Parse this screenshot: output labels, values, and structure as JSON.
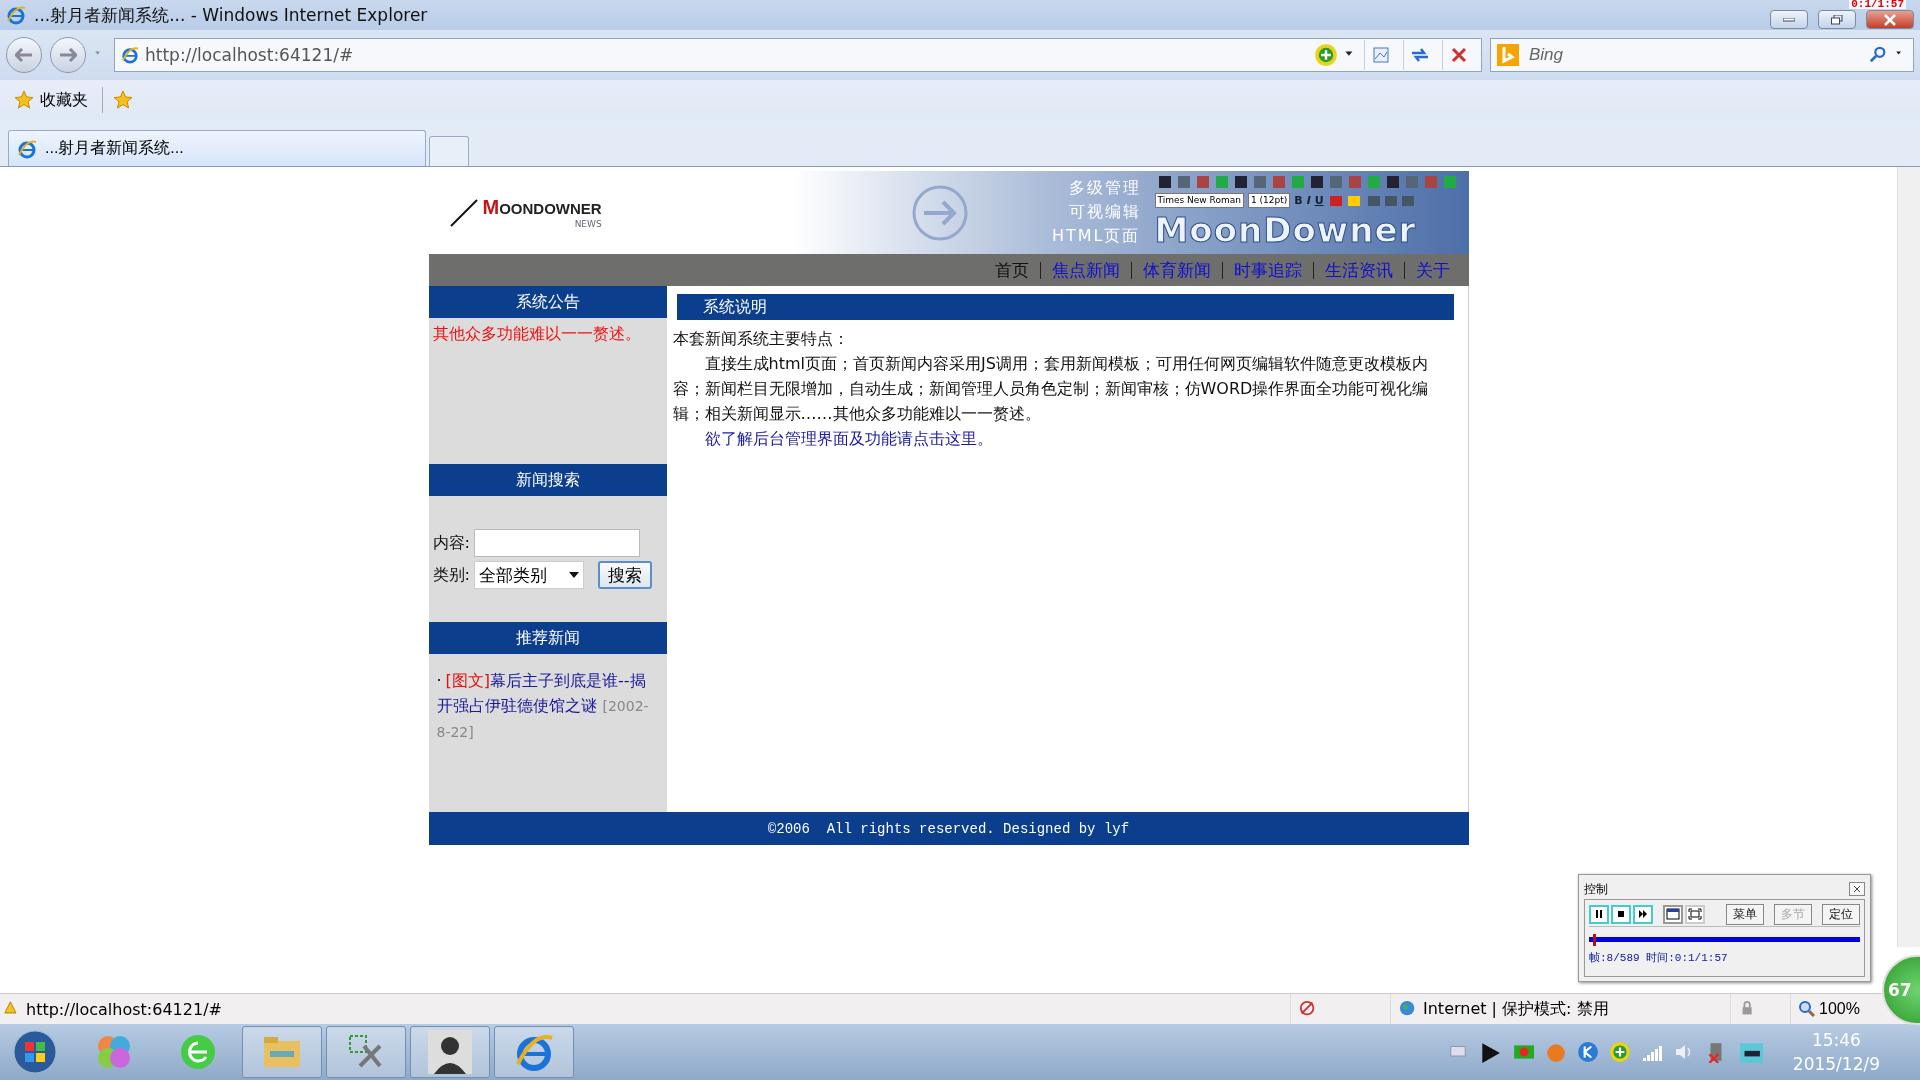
{
  "window": {
    "title": "...射月者新闻系统... - Windows Internet Explorer",
    "recorder_overlay": "0:1/1:57"
  },
  "address_bar": {
    "url": "http://localhost:64121/#"
  },
  "search_box": {
    "placeholder": "Bing"
  },
  "favorites_bar": {
    "label": "收藏夹"
  },
  "tabs": [
    {
      "label": "...射月者新闻系统...",
      "selected": true
    }
  ],
  "page": {
    "header": {
      "logo": "MOONDOWNER",
      "logo_sub": "NEWS",
      "features": [
        "多级管理",
        "可视编辑",
        "HTML页面"
      ],
      "editor_font": "Times New Roman",
      "editor_size": "1 (12pt)",
      "editor_buttons": [
        "B",
        "I",
        "U"
      ],
      "banner_text": "MoonDowner"
    },
    "nav": [
      {
        "label": "首页",
        "selected": true
      },
      {
        "label": "焦点新闻",
        "selected": false
      },
      {
        "label": "体育新闻",
        "selected": false
      },
      {
        "label": "时事追踪",
        "selected": false
      },
      {
        "label": "生活资讯",
        "selected": false
      },
      {
        "label": "关于",
        "selected": false
      }
    ],
    "sidebar": {
      "notice": {
        "title": "系统公告",
        "text": "其他众多功能难以一一赘述。"
      },
      "search": {
        "title": "新闻搜索",
        "content_label": "内容:",
        "category_label": "类别:",
        "category_value": "全部类别",
        "button": "搜索"
      },
      "recommended": {
        "title": "推荐新闻",
        "items": [
          {
            "bullet": "·",
            "tag": "[图文]",
            "title": "幕后主子到底是谁--揭开强占伊驻德使馆之谜",
            "date": "[2002-8-22]"
          }
        ]
      }
    },
    "main": {
      "title": "系统说明",
      "intro": "本套新闻系统主要特点：",
      "body": "直接生成html页面；首页新闻内容采用JS调用；套用新闻模板；可用任何网页编辑软件随意更改模板内容；新闻栏目无限增加，自动生成；新闻管理人员角色定制；新闻审核；仿WORD操作界面全功能可视化编辑；相关新闻显示……其他众多功能难以一一赘述。",
      "link": "欲了解后台管理界面及功能请点击这里。"
    },
    "footer": "©2006  All rights reserved. Designed by lyf"
  },
  "player": {
    "title": "控制",
    "buttons": [
      {
        "label": "菜单",
        "disabled": false
      },
      {
        "label": "多节",
        "disabled": true
      },
      {
        "label": "定位",
        "disabled": false
      }
    ],
    "level": 0.014,
    "info": "帧:8/589 时间:0:1/1:57"
  },
  "badge": {
    "text": "67"
  },
  "status_bar": {
    "url": "http://localhost:64121/#",
    "zone": "Internet | 保护模式: 禁用",
    "zoom": "100%"
  },
  "taskbar": {
    "time": "15:46",
    "date": "2015/12/9"
  }
}
